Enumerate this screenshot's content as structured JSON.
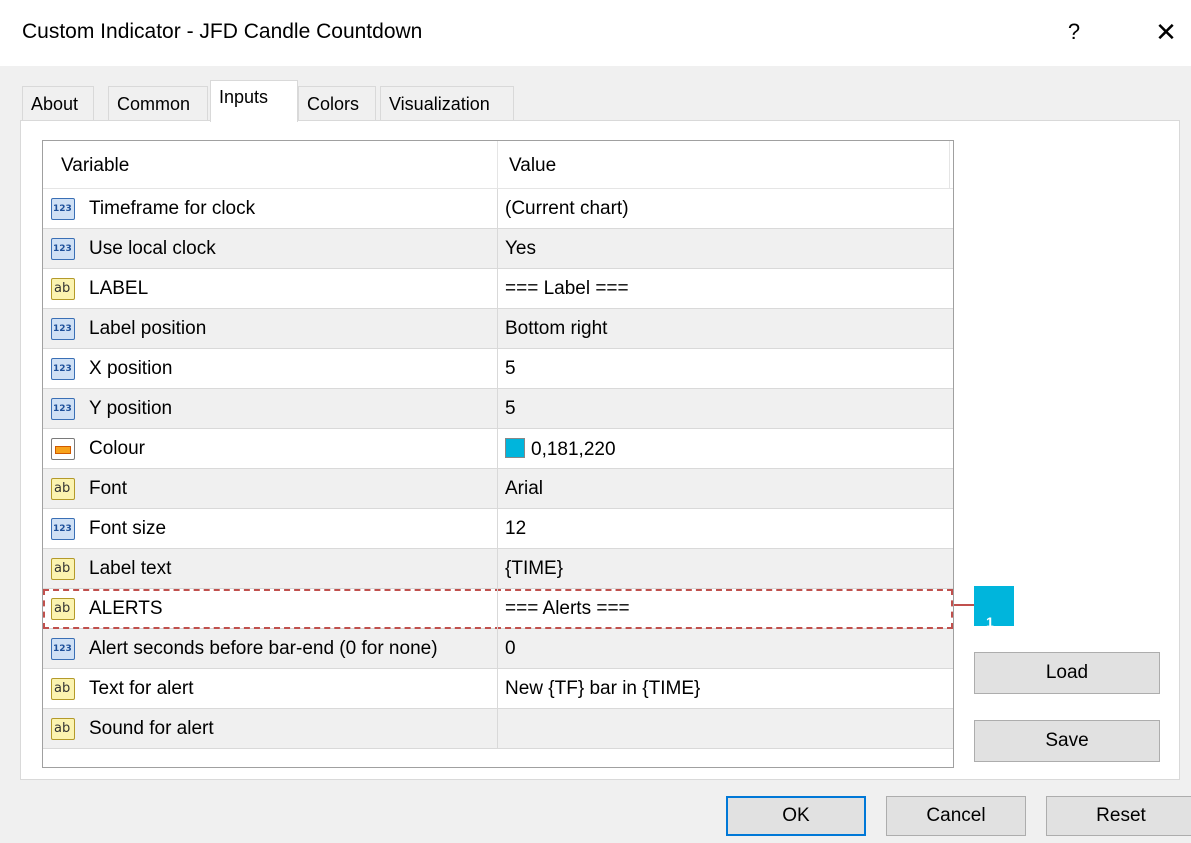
{
  "window": {
    "title": "Custom Indicator - JFD Candle Countdown",
    "help_label": "?",
    "close_label": "✕"
  },
  "tabs": [
    {
      "label": "About",
      "active": false
    },
    {
      "label": "Common",
      "active": false
    },
    {
      "label": "Inputs",
      "active": true
    },
    {
      "label": "Colors",
      "active": false
    },
    {
      "label": "Visualization",
      "active": false
    }
  ],
  "grid": {
    "columns": [
      "Variable",
      "Value"
    ],
    "rows": [
      {
        "type": "number",
        "icon": "number-type-icon",
        "variable": "Timeframe for clock",
        "value": "(Current chart)"
      },
      {
        "type": "number",
        "icon": "number-type-icon",
        "variable": "Use local clock",
        "value": "Yes"
      },
      {
        "type": "string",
        "icon": "string-type-icon",
        "variable": "LABEL",
        "value": "=== Label ==="
      },
      {
        "type": "number",
        "icon": "number-type-icon",
        "variable": "Label position",
        "value": "Bottom right"
      },
      {
        "type": "number",
        "icon": "number-type-icon",
        "variable": "X position",
        "value": "5"
      },
      {
        "type": "number",
        "icon": "number-type-icon",
        "variable": "Y position",
        "value": "5"
      },
      {
        "type": "color",
        "icon": "color-type-icon",
        "variable": "Colour",
        "value": "0,181,220",
        "swatch": "#00b5dc"
      },
      {
        "type": "string",
        "icon": "string-type-icon",
        "variable": "Font",
        "value": "Arial"
      },
      {
        "type": "number",
        "icon": "number-type-icon",
        "variable": "Font size",
        "value": "12"
      },
      {
        "type": "string",
        "icon": "string-type-icon",
        "variable": "Label text",
        "value": "{TIME}"
      },
      {
        "type": "string",
        "icon": "string-type-icon",
        "variable": "ALERTS",
        "value": "=== Alerts ===",
        "highlighted": true
      },
      {
        "type": "number",
        "icon": "number-type-icon",
        "variable": "Alert seconds before bar-end (0 for none)",
        "value": "0"
      },
      {
        "type": "string",
        "icon": "string-type-icon",
        "variable": "Text for alert",
        "value": "New {TF} bar in {TIME}"
      },
      {
        "type": "string",
        "icon": "string-type-icon",
        "variable": "Sound for alert",
        "value": ""
      }
    ]
  },
  "icons": {
    "number_glyph": "123",
    "string_glyph": "ab"
  },
  "callout": {
    "label": "1",
    "color": "#00b5dc"
  },
  "side_buttons": {
    "load": "Load",
    "save": "Save"
  },
  "footer_buttons": {
    "ok": "OK",
    "cancel": "Cancel",
    "reset": "Reset"
  }
}
